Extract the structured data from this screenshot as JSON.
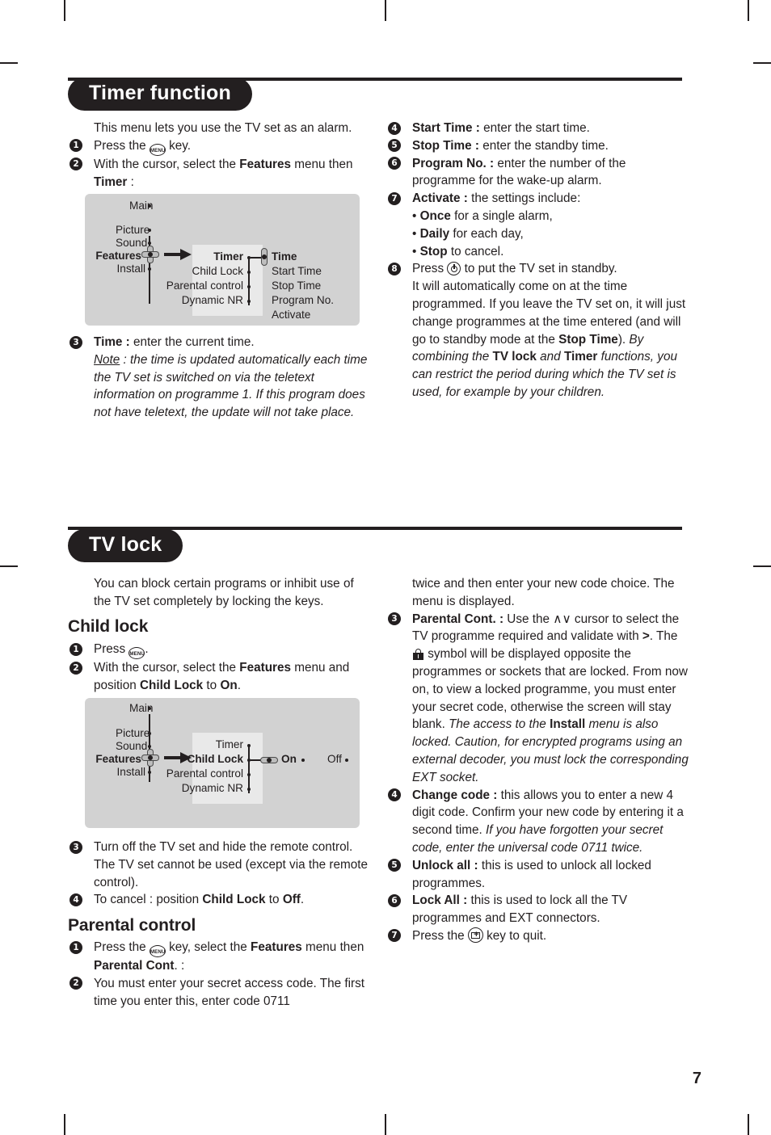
{
  "page": {
    "number": "7"
  },
  "sections": [
    {
      "id": "timer",
      "title": "Timer function",
      "left_column": {
        "lead": "This menu lets you use the TV set as an alarm.",
        "items": [
          {
            "num": "1",
            "text_before_icon": "Press the ",
            "icon": "menu-key-icon",
            "icon_label": "MENU",
            "text_after_icon": " key."
          },
          {
            "num": "2",
            "line1_a": "With the cursor, select the ",
            "line1_bold": "Features",
            "line1_b": " menu",
            "line2_a": "then ",
            "line2_bold": "Timer",
            "line2_b": " :"
          }
        ],
        "item3": {
          "num": "3",
          "bold": "Time :",
          "rest": " enter the current time.",
          "note_label": "Note",
          "note_body": " : the time is updated automatically each time the TV set is switched on via the teletext information on programme 1. If this program does not have teletext, the update will not take place."
        }
      },
      "right_column": {
        "items": [
          {
            "num": "4",
            "bold": "Start Time :",
            "rest": " enter the start time."
          },
          {
            "num": "5",
            "bold": "Stop Time :",
            "rest": " enter the standby time."
          },
          {
            "num": "6",
            "bold": "Program No. :",
            "rest": " enter the number of the programme for the wake-up alarm."
          },
          {
            "num": "7",
            "bold": "Activate :",
            "rest": " the settings include:"
          }
        ],
        "bullets": [
          {
            "marker": "•",
            "bold": "Once",
            "rest": " for a single alarm,"
          },
          {
            "marker": "•",
            "bold": "Daily",
            "rest": " for each day,"
          },
          {
            "marker": "•",
            "bold": "Stop",
            "rest": " to cancel."
          }
        ],
        "item8": {
          "num": "8",
          "before_icon": "Press ",
          "icon": "power-standby-icon",
          "after_icon": " to put the TV set in standby.",
          "body_a": "It will automatically come on at the time programmed. If you leave the TV set on, it will just change programmes at the time entered (and will go to standby mode at the ",
          "body_bold": "Stop Time",
          "body_b": ").",
          "italic_a": "By combining the ",
          "italic_bold1": "TV lock",
          "italic_mid": " and ",
          "italic_bold2": "Timer",
          "italic_b": " functions, you can restrict the period during which the TV set is used, for example by your children."
        }
      },
      "diagram": {
        "name": "timer-menu-navigation-diagram",
        "column1": [
          "Main",
          "Picture",
          "Sound",
          "Features",
          "Install"
        ],
        "column1_bold": "Features",
        "column2": [
          "Timer",
          "Child Lock",
          "Parental control",
          "Dynamic NR"
        ],
        "column2_bold": "Timer",
        "column3": [
          "Time",
          "Start Time",
          "Stop Time",
          "Program No.",
          "Activate"
        ],
        "column3_bold": "Time"
      }
    },
    {
      "id": "tvlock",
      "title": "TV lock",
      "left_column": {
        "lead": "You can block certain programs or inhibit use of the TV set completely by locking the keys.",
        "subhead1": "Child lock",
        "childlock_items": [
          {
            "num": "1",
            "before_icon": "Press ",
            "icon": "menu-key-icon",
            "after_icon": "."
          },
          {
            "num": "2",
            "line1_a": "With the cursor, select the ",
            "line1_bold": "Features",
            "line1_b": " menu",
            "line2_a": "and position ",
            "line2_bold": "Child Lock",
            "line2_mid": " to ",
            "line2_bold2": "On",
            "line2_b": "."
          }
        ],
        "childlock_items_after": [
          {
            "num": "3",
            "text": "Turn off the TV set and hide the remote control. The TV set cannot be used (except via the remote control)."
          },
          {
            "num": "4",
            "a": "To cancel : position ",
            "bold1": "Child Lock",
            "mid": " to ",
            "bold2": "Off",
            "b": "."
          }
        ],
        "subhead2": "Parental control",
        "parental_items": [
          {
            "num": "1",
            "line1_a": "Press the ",
            "icon": "menu-key-icon",
            "line1_b": " key, select the ",
            "line1_bold": "Features",
            "line1_c": " menu",
            "line2_a": "then ",
            "line2_bold": "Parental Cont",
            "line2_b": ". :"
          },
          {
            "num": "2",
            "text": "You must enter your secret access code. The first time you enter this, enter code 0711"
          }
        ]
      },
      "right_column": {
        "continuation": "twice and then enter your new code choice. The menu is displayed.",
        "item3": {
          "num": "3",
          "bold": "Parental Cont. :",
          "a": " Use the ",
          "cursor_glyphs": "∧∨",
          "b": " cursor to select the TV programme required and validate with ",
          "gt": ">",
          "c": ". The ",
          "icon": "lock-icon",
          "d": " symbol will be displayed opposite the programmes or sockets that are locked. From now on, to view a locked programme, you must enter your secret code, otherwise the screen will stay blank.",
          "italic_a": "The access to the ",
          "italic_bold": "Install",
          "italic_b": " menu is also locked. Caution, for encrypted programs using an external decoder, you must lock the corresponding EXT socket."
        },
        "item4": {
          "num": "4",
          "bold": "Change code :",
          "rest": " this allows you to enter a new 4 digit code. Confirm your new code by entering it a second time.",
          "italic": "If you have forgotten your secret code, enter the universal code 0711 twice."
        },
        "items": [
          {
            "num": "5",
            "bold": "Unlock all :",
            "rest": " this is used to unlock all locked programmes."
          },
          {
            "num": "6",
            "bold": "Lock All :",
            "rest": " this is used to lock all the TV programmes and EXT connectors."
          }
        ],
        "item7": {
          "num": "7",
          "before_icon": "Press the ",
          "icon": "exit-key-icon",
          "after_icon": " key to quit."
        }
      },
      "diagram": {
        "name": "childlock-menu-navigation-diagram",
        "column1": [
          "Main",
          "Picture",
          "Sound",
          "Features",
          "Install"
        ],
        "column1_bold": "Features",
        "column2": [
          "Timer",
          "Child Lock",
          "Parental control",
          "Dynamic NR"
        ],
        "column2_bold": "Child Lock",
        "column3": [
          "On",
          "Off"
        ],
        "column3_bold": "On"
      }
    }
  ],
  "colors": {
    "ink": "#231f20",
    "diagram_bg": "#d2d2d2",
    "diagram_panel": "#e9e9e9"
  }
}
